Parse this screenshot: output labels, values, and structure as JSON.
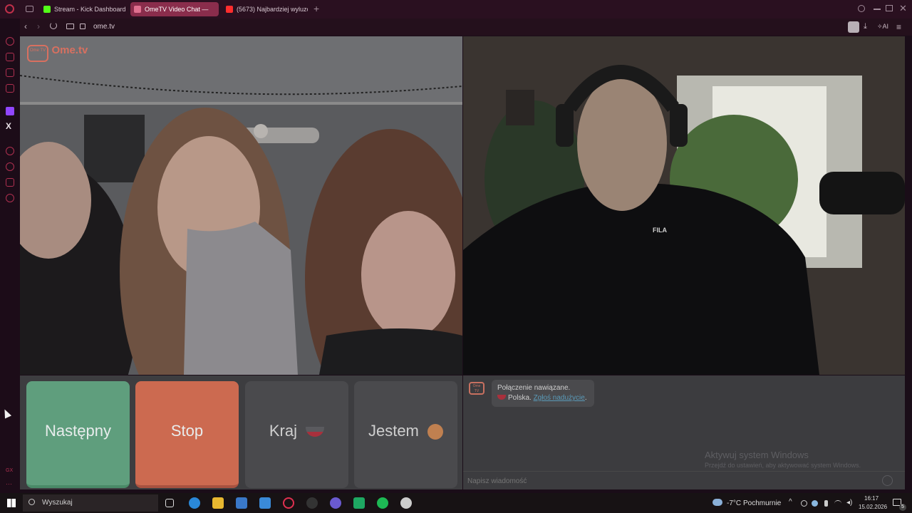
{
  "browser": {
    "tabs": [
      {
        "label": "Stream - Kick Dashboard",
        "color": "#53fc18"
      },
      {
        "label": "OmeTV Video Chat —",
        "color": "#e07090"
      },
      {
        "label": "(5673) Najbardziej wyluzo",
        "color": "#ff2d2d"
      }
    ],
    "url": "ome.tv",
    "ai_label": "AI",
    "sidebar_gx": "GX"
  },
  "site": {
    "logo_badge": "Ome TV",
    "logo_text": "Ome.tv"
  },
  "controls": {
    "next_label": "Następny",
    "stop_label": "Stop",
    "country_label": "Kraj",
    "iam_label": "Jestem"
  },
  "chat": {
    "badge": "Ome TV",
    "status_line": "Połączenie nawiązane.",
    "country": "Polska.",
    "report_link": "Zgłoś nadużycie",
    "input_placeholder": "Napisz wiadomość",
    "watermark_title": "Aktywuj system Windows",
    "watermark_sub": "Przejdź do ustawień, aby aktywować system Windows."
  },
  "video": {
    "shirt_text": "FILA"
  },
  "taskbar": {
    "search_placeholder": "Wyszukaj",
    "weather_temp": "-7°C",
    "weather_desc": "Pochmurnie",
    "time": "16:17",
    "date": "15.02.2026",
    "notif_count": "5"
  },
  "colors": {
    "next": "#5f9e7d",
    "stop": "#cc6a50",
    "neutral": "#4a4a4d"
  }
}
